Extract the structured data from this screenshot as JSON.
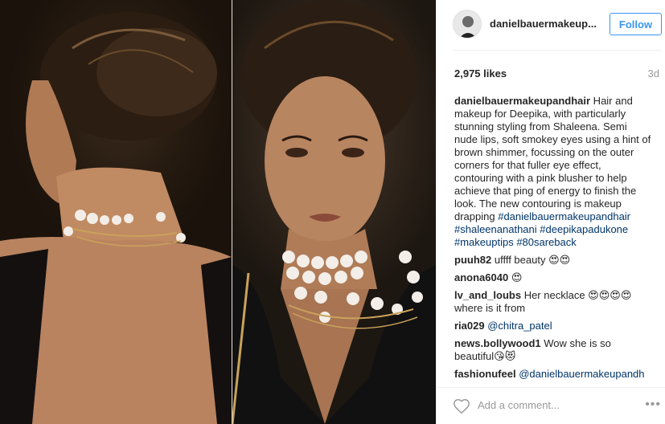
{
  "post": {
    "username": "danielbauermakeup...",
    "follow_label": "Follow",
    "likes": "2,975 likes",
    "time": "3d",
    "add_comment_placeholder": "Add a comment...",
    "more_label": "•••"
  },
  "caption": {
    "user": "danielbauermakeupandhair",
    "text": " Hair and makeup for Deepika, with particularly stunning styling from Shaleena. Semi nude lips, soft smokey eyes using a hint of brown shimmer, focussing on the outer corners for that fuller eye effect, contouring with a pink blusher to help achieve that ping of energy to finish the look. The new contouring is makeup drapping ",
    "tags": "#danielbauermakeupandhair #shaleenanathani #deepikapadukone #makeuptips #80sareback"
  },
  "comments": [
    {
      "user": "puuh82",
      "text": " uffff beauty 😍😍"
    },
    {
      "user": "anona6040",
      "text": " 😍"
    },
    {
      "user": "lv_and_loubs",
      "text": " Her necklace 😍😍😍😍 where is it from"
    },
    {
      "user": "ria029",
      "text": " ",
      "mention": "@chitra_patel"
    },
    {
      "user": "news.bollywood1",
      "text": " Wow she is so beautiful😘😻"
    },
    {
      "user": "fashionufeel",
      "text": " ",
      "mention": "@danielbauermakeupandh"
    }
  ],
  "icons": {
    "avatar": "profile-avatar",
    "heart": "heart-icon",
    "more": "more-options-icon"
  },
  "colors": {
    "accent": "#3897f0",
    "hashtag": "#003569",
    "muted": "#999999"
  }
}
